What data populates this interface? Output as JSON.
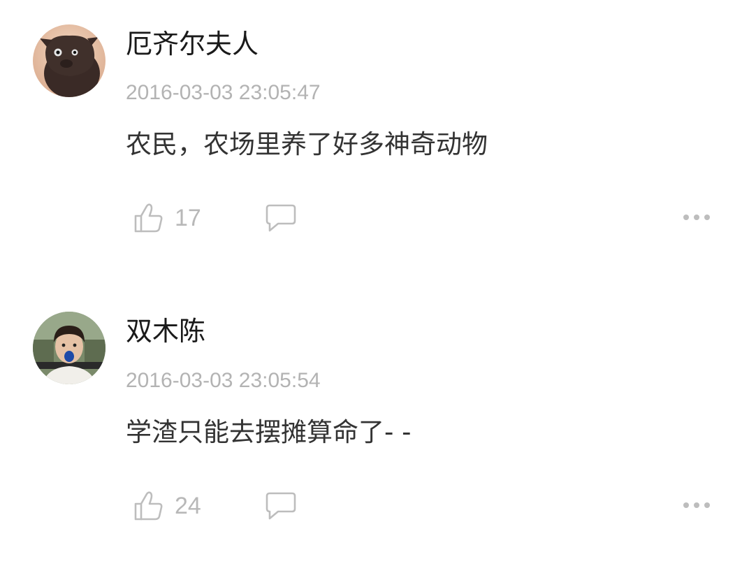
{
  "comments": [
    {
      "username": "厄齐尔夫人",
      "timestamp": "2016-03-03 23:05:47",
      "content": "农民，农场里养了好多神奇动物",
      "likes": "17",
      "avatar_icon": "dark-cat-avatar"
    },
    {
      "username": "双木陈",
      "timestamp": "2016-03-03 23:05:54",
      "content": "学渣只能去摆摊算命了- -",
      "likes": "24",
      "avatar_icon": "child-photo-avatar"
    }
  ],
  "colors": {
    "username": "#1a1a1a",
    "timestamp": "#b3b3b3",
    "content": "#333333",
    "icon": "#bdbdbd"
  }
}
